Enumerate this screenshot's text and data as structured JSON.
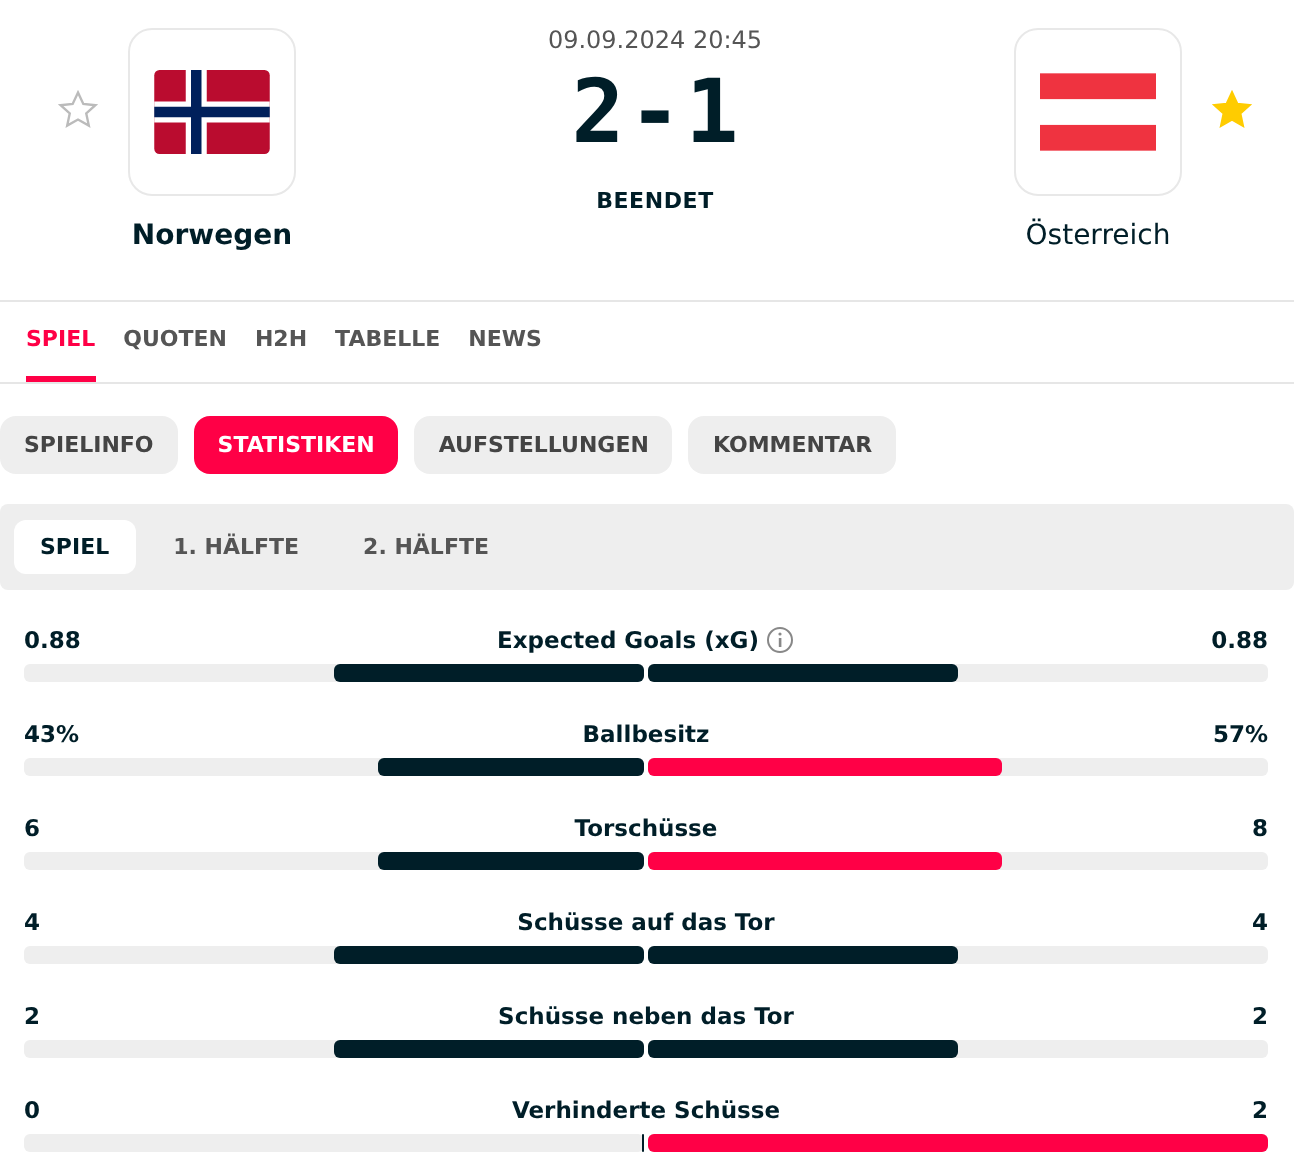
{
  "match": {
    "datetime": "09.09.2024 20:45",
    "score_home": "2",
    "score_separator": "-",
    "score_away": "1",
    "status": "BEENDET"
  },
  "home": {
    "name": "Norwegen",
    "kind": "norway",
    "favorite": false,
    "winner": true
  },
  "away": {
    "name": "Österreich",
    "kind": "austria",
    "favorite": true,
    "winner": false
  },
  "tabs": [
    {
      "label": "SPIEL",
      "selected": true
    },
    {
      "label": "QUOTEN",
      "selected": false
    },
    {
      "label": "H2H",
      "selected": false
    },
    {
      "label": "TABELLE",
      "selected": false
    },
    {
      "label": "NEWS",
      "selected": false
    }
  ],
  "pills": [
    {
      "label": "SPIELINFO",
      "selected": false
    },
    {
      "label": "STATISTIKEN",
      "selected": true
    },
    {
      "label": "AUFSTELLUNGEN",
      "selected": false
    },
    {
      "label": "KOMMENTAR",
      "selected": false
    }
  ],
  "periods": [
    {
      "label": "SPIEL",
      "selected": true
    },
    {
      "label": "1. HÄLFTE",
      "selected": false
    },
    {
      "label": "2. HÄLFTE",
      "selected": false
    }
  ],
  "stats": [
    {
      "label": "Expected Goals (xG)",
      "info": true,
      "home": {
        "value": "0.88",
        "level": 0.5,
        "highlighted": false
      },
      "away": {
        "value": "0.88",
        "level": 0.5,
        "highlighted": false
      }
    },
    {
      "label": "Ballbesitz",
      "info": false,
      "home": {
        "value": "43%",
        "level": 0.43,
        "highlighted": false
      },
      "away": {
        "value": "57%",
        "level": 0.57,
        "highlighted": true
      }
    },
    {
      "label": "Torschüsse",
      "info": false,
      "home": {
        "value": "6",
        "level": 0.43,
        "highlighted": false
      },
      "away": {
        "value": "8",
        "level": 0.57,
        "highlighted": true
      }
    },
    {
      "label": "Schüsse auf das Tor",
      "info": false,
      "home": {
        "value": "4",
        "level": 0.5,
        "highlighted": false
      },
      "away": {
        "value": "4",
        "level": 0.5,
        "highlighted": false
      }
    },
    {
      "label": "Schüsse neben das Tor",
      "info": false,
      "home": {
        "value": "2",
        "level": 0.5,
        "highlighted": false
      },
      "away": {
        "value": "2",
        "level": 0.5,
        "highlighted": false
      }
    },
    {
      "label": "Verhinderte Schüsse",
      "info": false,
      "home": {
        "value": "0",
        "level": 0
      },
      "away": {
        "value": "2",
        "level": 1,
        "highlighted": true
      }
    }
  ]
}
